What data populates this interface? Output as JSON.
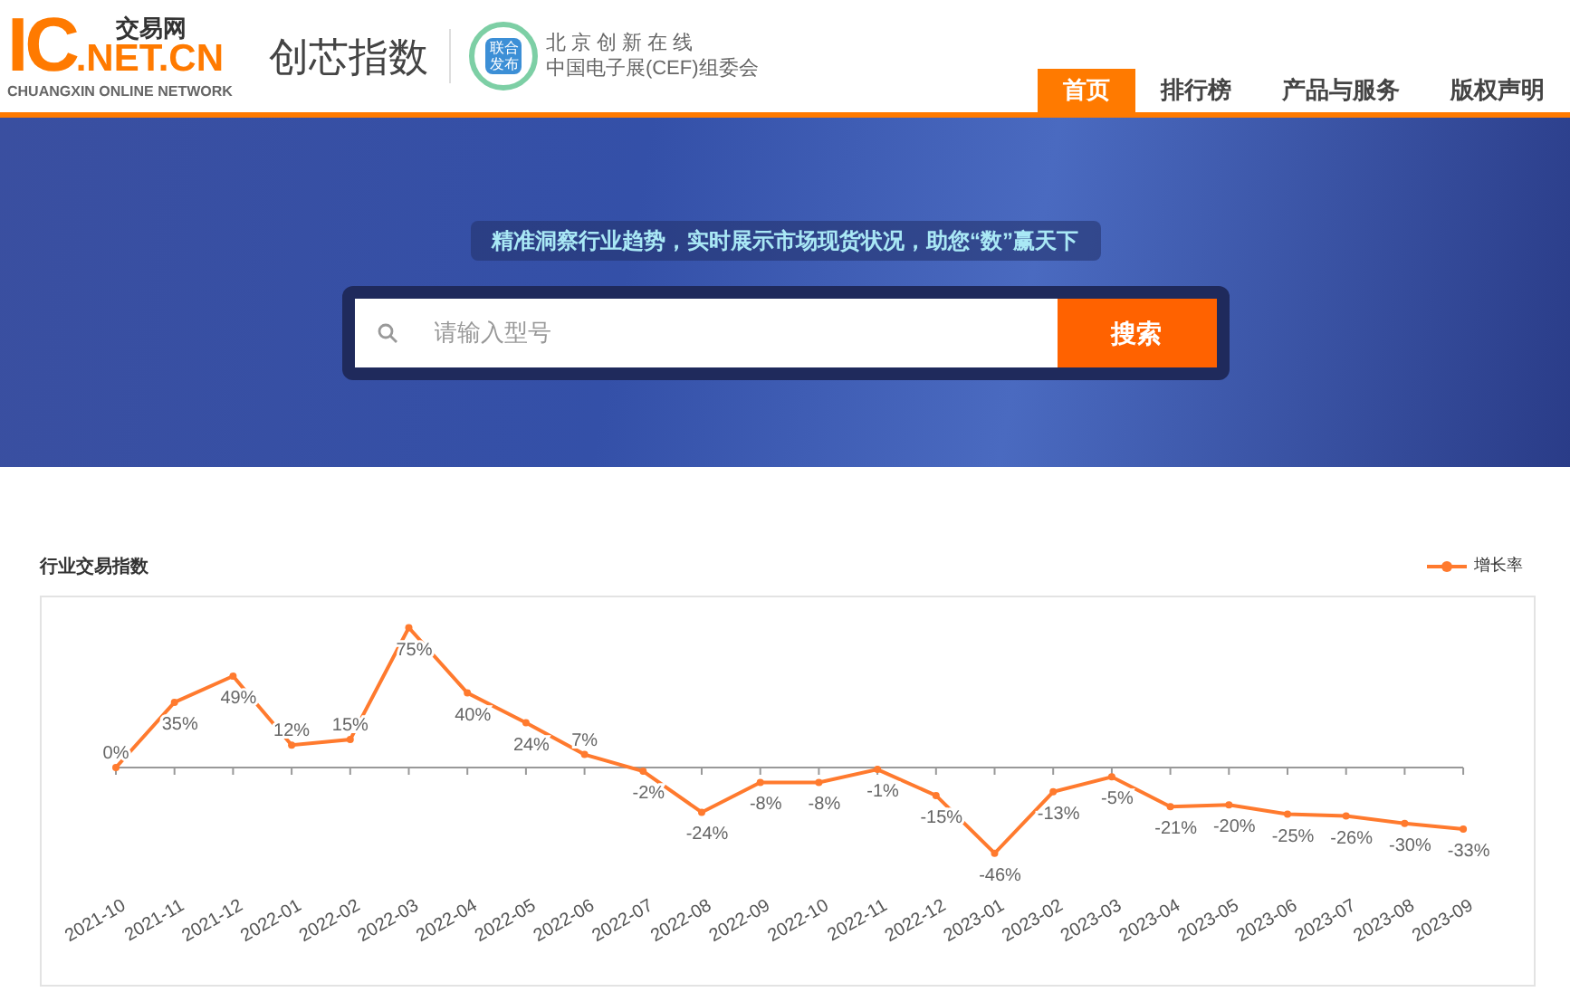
{
  "header": {
    "logo": {
      "mark": "IC",
      "domain": ".NET.CN",
      "name_cn": "交易网",
      "tagline": "CHUANGXIN ONLINE NETWORK"
    },
    "product": "创芯指数",
    "badge": {
      "seal": "联合发布",
      "line_1": "北 京 创 新 在 线",
      "line_2": "中国电子展(CEF)组委会"
    }
  },
  "nav": [
    {
      "label": "首页",
      "selected": true
    },
    {
      "label": "排行榜",
      "selected": false
    },
    {
      "label": "产品与服务",
      "selected": false
    },
    {
      "label": "版权声明",
      "selected": false
    }
  ],
  "banner": {
    "slogan": "精准洞察行业趋势，实时展示市场现货状况，助您“数”赢天下",
    "search": {
      "placeholder": "请输入型号",
      "button": "搜索"
    }
  },
  "index_chart": {
    "title": "行业交易指数",
    "chart_data": {
      "type": "line",
      "categories": [
        "2021-10",
        "2021-11",
        "2021-12",
        "2022-01",
        "2022-02",
        "2022-03",
        "2022-04",
        "2022-05",
        "2022-06",
        "2022-07",
        "2022-08",
        "2022-09",
        "2022-10",
        "2022-11",
        "2022-12",
        "2023-01",
        "2023-02",
        "2023-03",
        "2023-04",
        "2023-05",
        "2023-06",
        "2023-07",
        "2023-08",
        "2023-09"
      ],
      "series": [
        {
          "name": "增长率",
          "color": "#ff7a2e",
          "marker": "circle",
          "values": [
            0,
            35,
            49,
            12,
            15,
            75,
            40,
            24,
            7,
            -2,
            -24,
            -8,
            -8,
            -1,
            -15,
            -46,
            -13,
            -5,
            -21,
            -20,
            -25,
            -26,
            -30,
            -33
          ],
          "value_labels": [
            "0%",
            "35%",
            "49%",
            "12%",
            "15%",
            "75%",
            "40%",
            "24%",
            "7%",
            "-2%",
            "-24%",
            "-8%",
            "-8%",
            "-1%",
            "-15%",
            "-46%",
            "-13%",
            "-5%",
            "-21%",
            "-20%",
            "-25%",
            "-26%",
            "-30%",
            "-33%"
          ]
        }
      ]
    }
  }
}
